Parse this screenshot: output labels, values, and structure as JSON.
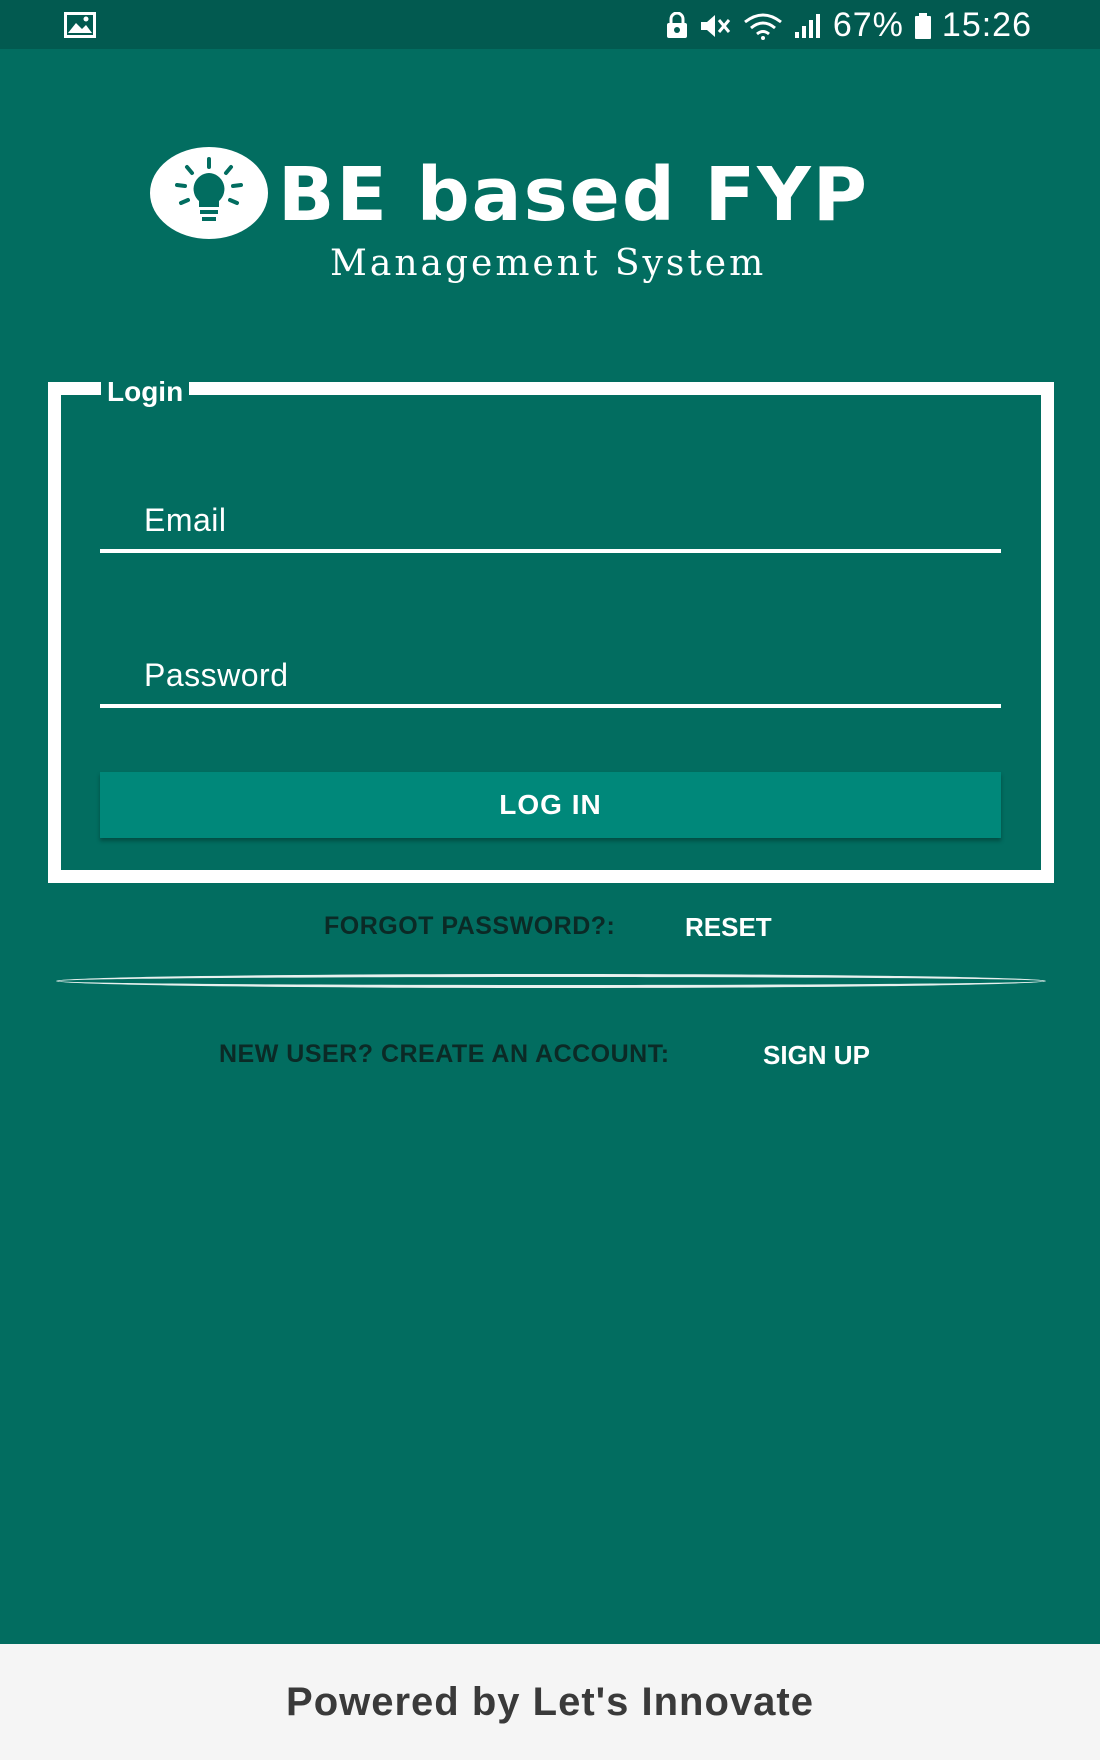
{
  "status_bar": {
    "gallery_icon": "image-icon",
    "battery_percent": "67%",
    "time": "15:26",
    "icons": [
      "lock-icon",
      "mute-icon",
      "wifi-icon",
      "signal-icon",
      "battery-icon"
    ]
  },
  "logo": {
    "title": "BE based FYP",
    "subtitle": "Management System",
    "icon": "lightbulb-icon"
  },
  "login": {
    "legend": "Login",
    "email_placeholder": "Email",
    "password_placeholder": "Password",
    "login_button": "LOG IN"
  },
  "forgot": {
    "label": "FORGOT PASSWORD?:",
    "link": "RESET"
  },
  "signup": {
    "label": "NEW USER? CREATE AN ACCOUNT:",
    "link": "SIGN UP"
  },
  "footer": {
    "text": "Powered by Let's Innovate"
  },
  "colors": {
    "background": "#026d60",
    "status_bar": "#025a50",
    "button": "#00887a",
    "footer_bg": "#f5f5f5"
  }
}
